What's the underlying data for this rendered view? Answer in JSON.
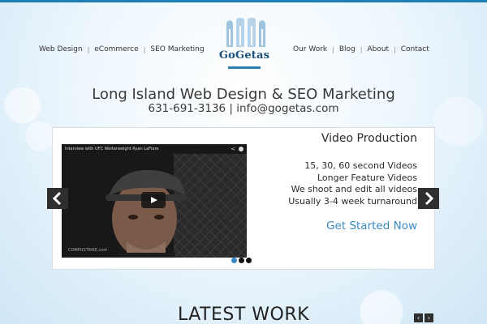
{
  "nav_left": [
    {
      "label": "Web Design"
    },
    {
      "label": "eCommerce"
    },
    {
      "label": "SEO Marketing"
    }
  ],
  "nav_right": [
    {
      "label": "Our Work"
    },
    {
      "label": "Blog"
    },
    {
      "label": "About"
    },
    {
      "label": "Contact"
    }
  ],
  "nav_separator": "|",
  "logo": {
    "text": "GoGetas"
  },
  "headline": "Long Island Web Design & SEO Marketing",
  "contact_line": "631-691-3136 | info@gogetas.com",
  "slide": {
    "title": "Video Production",
    "features": [
      "15, 30, 60 second Videos",
      "Longer Feature Videos",
      "We shoot and edit all videos",
      "Usually 3-4 week turnaround"
    ],
    "cta": "Get Started Now",
    "video_title": "Interview with UFC Welterweight Ryan LaFlare",
    "video_watermark": "COMPUSTRIKE.com"
  },
  "section_heading": "LATEST WORK",
  "colors": {
    "accent": "#3a89c2",
    "brand_dark": "#1a4f7a",
    "top_bar": "#1f7fb3"
  },
  "icons": {
    "prev": "chevron-left-icon",
    "next": "chevron-right-icon",
    "share": "share-icon",
    "play": "play-icon"
  }
}
